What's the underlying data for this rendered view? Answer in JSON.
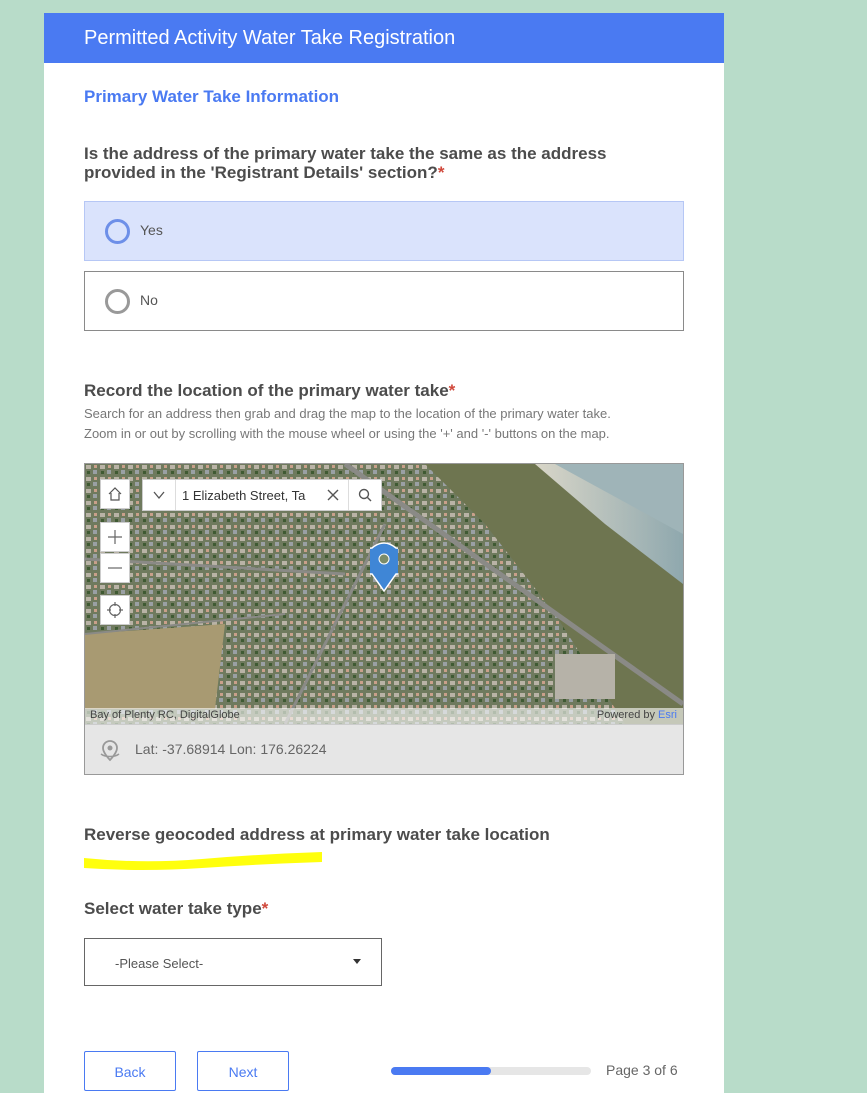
{
  "header": {
    "title": "Permitted Activity Water Take Registration"
  },
  "section": {
    "title": "Primary Water Take Information"
  },
  "q1": {
    "line1": "Is the address of the primary water take the same as the address",
    "line2": "provided in the 'Registrant Details' section?",
    "required": "*",
    "options": [
      "Yes",
      "No"
    ],
    "selected": "Yes"
  },
  "q2": {
    "title": "Record the location of the primary water take",
    "required": "*",
    "desc1": "Search for an address then grab and drag the map to the location of the primary water take.",
    "desc2": "Zoom in or out by scrolling with the mouse wheel or using the '+' and '-' buttons on the map."
  },
  "map": {
    "search_value": "1 Elizabeth Street, Ta",
    "attribution_left": "Bay of Plenty RC, DigitalGlobe",
    "attribution_powered": "Powered by",
    "attribution_esri": "Esri",
    "coords": "Lat: -37.68914  Lon: 176.26224",
    "icons": [
      "home-icon",
      "dropdown-icon",
      "clear-icon",
      "search-icon",
      "zoom-in-icon",
      "zoom-out-icon",
      "locate-icon",
      "map-pin-icon",
      "location-icon"
    ]
  },
  "q3": {
    "title": "Reverse geocoded address at primary water take location"
  },
  "q4": {
    "title": "Select water take type",
    "required": "*",
    "placeholder": "-Please Select-"
  },
  "nav": {
    "back": "Back",
    "next": "Next",
    "page": "Page 3 of 6",
    "progress": 0.5
  },
  "colors": {
    "accent": "#4a7af2",
    "header": "#4a7af2",
    "required": "#d0473a",
    "background": "#b8dcc9",
    "highlight": "#ffff00"
  }
}
